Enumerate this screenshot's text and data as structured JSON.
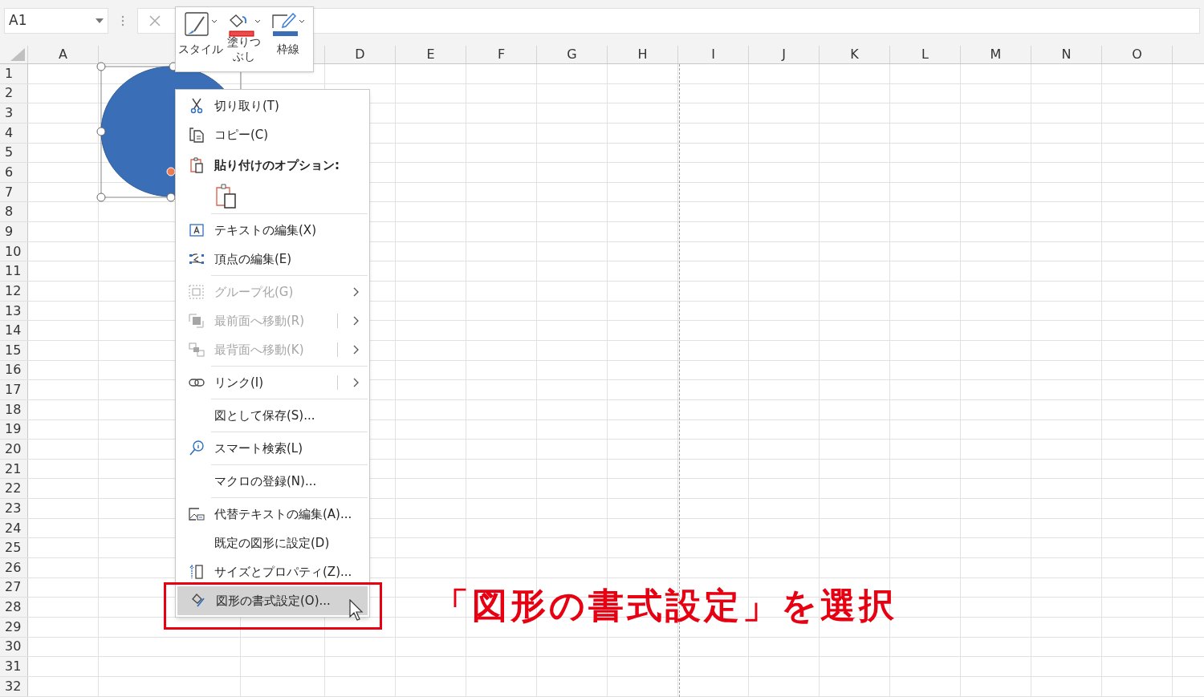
{
  "name_box": {
    "value": "A1"
  },
  "mini_toolbar": {
    "buttons": [
      {
        "label": "スタイル"
      },
      {
        "label": "塗りつぶし"
      },
      {
        "label": "枠線"
      }
    ]
  },
  "sheet": {
    "columns": [
      "A",
      "D",
      "E",
      "F",
      "G",
      "H",
      "I",
      "J",
      "K",
      "L",
      "M",
      "N",
      "O"
    ],
    "rows": [
      "1",
      "2",
      "3",
      "4",
      "5",
      "6",
      "7",
      "8",
      "9",
      "10",
      "11",
      "12",
      "13",
      "14",
      "15",
      "16",
      "17",
      "18",
      "19",
      "20",
      "21",
      "22",
      "23",
      "24",
      "25",
      "26",
      "27",
      "28",
      "29",
      "30",
      "31",
      "32"
    ]
  },
  "context_menu": {
    "items": [
      {
        "kind": "item",
        "label": "切り取り(T)",
        "disabled": false,
        "selected": false
      },
      {
        "kind": "item",
        "label": "コピー(C)",
        "disabled": false,
        "selected": false
      },
      {
        "kind": "heading",
        "label": "貼り付けのオプション:"
      },
      {
        "kind": "paste_options"
      },
      {
        "kind": "separator"
      },
      {
        "kind": "item",
        "label": "テキストの編集(X)",
        "disabled": false,
        "selected": false
      },
      {
        "kind": "item",
        "label": "頂点の編集(E)",
        "disabled": false,
        "selected": false
      },
      {
        "kind": "separator"
      },
      {
        "kind": "item",
        "label": "グループ化(G)",
        "disabled": true,
        "selected": false,
        "has_submenu": true,
        "divider": false
      },
      {
        "kind": "item",
        "label": "最前面へ移動(R)",
        "disabled": true,
        "selected": false,
        "has_submenu": true,
        "divider": true
      },
      {
        "kind": "item",
        "label": "最背面へ移動(K)",
        "disabled": true,
        "selected": false,
        "has_submenu": true,
        "divider": true
      },
      {
        "kind": "separator"
      },
      {
        "kind": "item",
        "label": "リンク(I)",
        "disabled": false,
        "selected": false,
        "has_submenu": true,
        "divider": true
      },
      {
        "kind": "separator"
      },
      {
        "kind": "item",
        "label": "図として保存(S)...",
        "disabled": false,
        "selected": false
      },
      {
        "kind": "separator"
      },
      {
        "kind": "item",
        "label": "スマート検索(L)",
        "disabled": false,
        "selected": false
      },
      {
        "kind": "separator"
      },
      {
        "kind": "item",
        "label": "マクロの登録(N)...",
        "disabled": false,
        "selected": false
      },
      {
        "kind": "separator"
      },
      {
        "kind": "item",
        "label": "代替テキストの編集(A)...",
        "disabled": false,
        "selected": false
      },
      {
        "kind": "item",
        "label": "既定の図形に設定(D)",
        "disabled": false,
        "selected": false
      },
      {
        "kind": "item",
        "label": "サイズとプロパティ(Z)...",
        "disabled": false,
        "selected": false
      },
      {
        "kind": "item",
        "label": "図形の書式設定(O)...",
        "disabled": false,
        "selected": true
      }
    ]
  },
  "annotation": {
    "text": "「図形の書式設定」を選択"
  }
}
